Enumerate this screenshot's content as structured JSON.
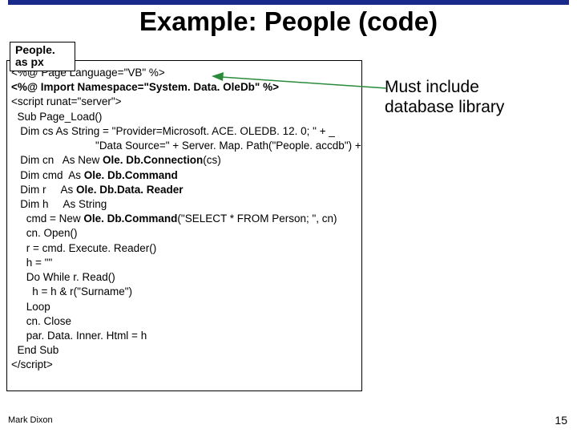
{
  "title": "Example: People (code)",
  "filename": "People. as\npx",
  "code": {
    "l1": "<%@ Page Language=\"VB\" %>",
    "l2a": "<%@ Import Namespace=\"System. Data. Ole",
    "l2b": "Db\" %>",
    "l3": "<script runat=\"server\">",
    "l4": "  Sub Page_Load()",
    "l5a": "   Dim cs As String = \"Provider=Microsoft. ACE. OLEDB. 12. 0; \" + _",
    "l6": "                            \"Data Source=\" + Server. Map. Path(\"People. accdb\") + \"; \"",
    "l7a": "   Dim cn   As New ",
    "l7b": "Ole. Db.Connection",
    "l7c": "(cs)",
    "l8a": "   Dim cmd  As ",
    "l8b": "Ole. Db.Command",
    "l9a": "   Dim r     As ",
    "l9b": "Ole. Db.Data. Reader",
    "l10": "   Dim h     As String",
    "l11a": "     cmd = New ",
    "l11b": "Ole. Db.Command",
    "l11c": "(\"SELECT * FROM Person; \", cn)",
    "l12": "     cn. Open()",
    "l13": "     r = cmd. Execute. Reader()",
    "l14": "     h = \"\"",
    "l15": "     Do While r. Read()",
    "l16": "       h = h & r(\"Surname\")",
    "l17": "     Loop",
    "l18": "     cn. Close",
    "l19": "     par. Data. Inner. Html = h",
    "l20": "  End Sub",
    "l21": "</script>"
  },
  "annotation": {
    "line1": "Must include",
    "line2": "database library"
  },
  "footer": {
    "author": "Mark Dixon",
    "page": "15"
  },
  "colors": {
    "bar": "#1a2a8a",
    "arrow": "#2a8a3a"
  }
}
